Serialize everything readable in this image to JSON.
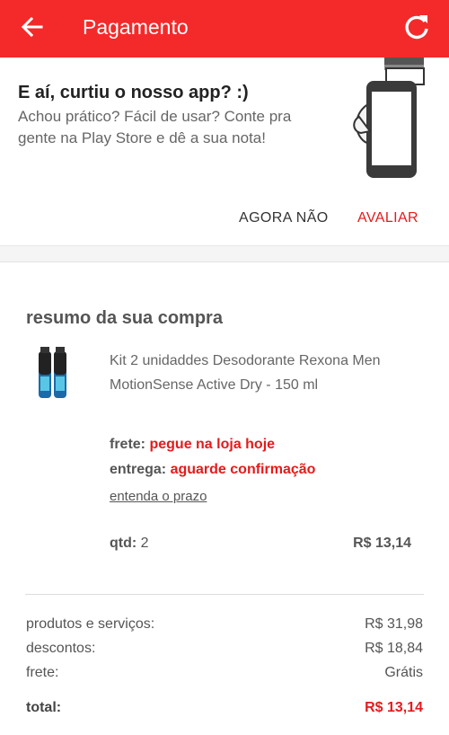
{
  "appbar": {
    "title": "Pagamento",
    "back_icon": "arrow-left-icon",
    "refresh_icon": "refresh-icon",
    "color": "#f42a2a"
  },
  "rate_prompt": {
    "title": "E aí, curtiu o nosso app? :)",
    "body": "Achou prático? Fácil de usar? Conte pra gente na Play Store e dê a sua nota!",
    "later_label": "AGORA NÃO",
    "rate_label": "AVALIAR",
    "illustration": "hand-holding-phone-icon"
  },
  "summary": {
    "title": "resumo da sua compra",
    "product": {
      "name": "Kit 2 unidaddes Desodorante Rexona Men MotionSense Active Dry - 150 ml",
      "image": "deodorant-cans-icon"
    },
    "frete_label": "frete:",
    "frete_value": "pegue na loja hoje",
    "entrega_label": "entrega:",
    "entrega_value": "aguarde confirmação",
    "prazo_link": "entenda o prazo",
    "qtd_label": "qtd:",
    "qtd_value": "2",
    "item_price": "R$ 13,14"
  },
  "totals": {
    "rows": [
      {
        "label": "produtos e serviços:",
        "value": "R$ 31,98"
      },
      {
        "label": "descontos:",
        "value": "R$ 18,84"
      },
      {
        "label": "frete:",
        "value": "Grátis"
      }
    ],
    "total_label": "total:",
    "total_value": "R$ 13,14"
  },
  "accent_color": "#e41b1b"
}
